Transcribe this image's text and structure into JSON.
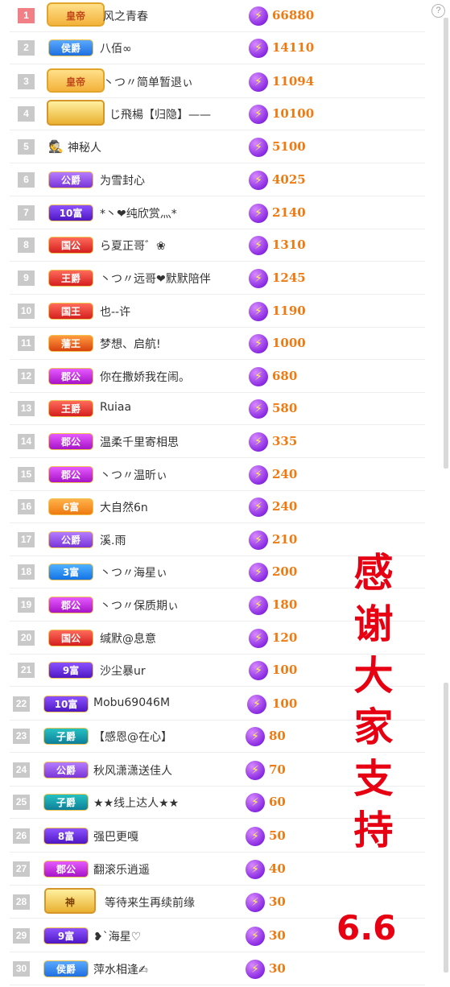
{
  "help_icon": "?",
  "coin_glyph": "⚡",
  "rows": [
    {
      "rank": "1",
      "badge": "皇帝",
      "badge_style": "crown",
      "name": "风之青春",
      "score": "66880"
    },
    {
      "rank": "2",
      "badge": "侯爵",
      "badge_style": "blue",
      "name": "八佰∞",
      "score": "14110"
    },
    {
      "rank": "3",
      "badge": "皇帝",
      "badge_style": "crown",
      "name": "丶つ〃简单暂退ぃ",
      "score": "11094"
    },
    {
      "rank": "4",
      "badge": "",
      "badge_style": "gold",
      "name": "じ飛楊【归隐】——",
      "score": "10100"
    },
    {
      "rank": "5",
      "badge": "",
      "badge_style": "mystery",
      "name": "神秘人",
      "score": "5100"
    },
    {
      "rank": "6",
      "badge": "公爵",
      "badge_style": "purple",
      "name": "为雪封心",
      "score": "4025"
    },
    {
      "rank": "7",
      "badge": "10富",
      "badge_style": "violet",
      "name": "*丶❤纯欣赏灬*",
      "score": "2140"
    },
    {
      "rank": "8",
      "badge": "国公",
      "badge_style": "red",
      "name": "ら夏正哥゛❀",
      "score": "1310"
    },
    {
      "rank": "9",
      "badge": "王爵",
      "badge_style": "red",
      "name": "丶つ〃远哥❤默默陪伴",
      "score": "1245"
    },
    {
      "rank": "10",
      "badge": "国王",
      "badge_style": "red",
      "name": "也--许",
      "score": "1190"
    },
    {
      "rank": "11",
      "badge": "藩王",
      "badge_style": "orange",
      "name": "梦想、启航!",
      "score": "1000"
    },
    {
      "rank": "12",
      "badge": "郡公",
      "badge_style": "magenta",
      "name": "你在撒娇我在闹。",
      "score": "680"
    },
    {
      "rank": "13",
      "badge": "王爵",
      "badge_style": "red",
      "name": "Ruiaa",
      "score": "580"
    },
    {
      "rank": "14",
      "badge": "郡公",
      "badge_style": "magenta",
      "name": "温柔千里寄相思",
      "score": "335"
    },
    {
      "rank": "15",
      "badge": "郡公",
      "badge_style": "magenta",
      "name": "丶つ〃温昕ぃ",
      "score": "240"
    },
    {
      "rank": "16",
      "badge": "6富",
      "badge_style": "orange2",
      "name": "大自然6n",
      "score": "240"
    },
    {
      "rank": "17",
      "badge": "公爵",
      "badge_style": "purple",
      "name": "溪.雨",
      "score": "210"
    },
    {
      "rank": "18",
      "badge": "3富",
      "badge_style": "blue2",
      "name": "丶つ〃海星ぃ",
      "score": "200"
    },
    {
      "rank": "19",
      "badge": "郡公",
      "badge_style": "magenta",
      "name": "丶つ〃保质期ぃ",
      "score": "180"
    },
    {
      "rank": "20",
      "badge": "国公",
      "badge_style": "red",
      "name": "缄默@息意",
      "score": "120"
    },
    {
      "rank": "21",
      "badge": "9富",
      "badge_style": "violet",
      "name": "沙尘暴ur",
      "score": "100"
    },
    {
      "rank": "22",
      "badge": "10富",
      "badge_style": "violet",
      "name": "Mobu69046M",
      "score": "100"
    },
    {
      "rank": "23",
      "badge": "子爵",
      "badge_style": "teal",
      "name": "【感恩@在心】",
      "score": "80"
    },
    {
      "rank": "24",
      "badge": "公爵",
      "badge_style": "purple",
      "name": "秋风潇潇送佳人",
      "score": "70"
    },
    {
      "rank": "25",
      "badge": "子爵",
      "badge_style": "teal",
      "name": "★★线上达人★★",
      "score": "60"
    },
    {
      "rank": "26",
      "badge": "8富",
      "badge_style": "violet",
      "name": "强巴更嘎",
      "score": "50"
    },
    {
      "rank": "27",
      "badge": "郡公",
      "badge_style": "magenta",
      "name": "翻滚乐逍遥",
      "score": "40"
    },
    {
      "rank": "28",
      "badge": "神",
      "badge_style": "gold2",
      "name": "等待来生再续前缘",
      "score": "30"
    },
    {
      "rank": "29",
      "badge": "9富",
      "badge_style": "violet",
      "name": "❥`海星♡",
      "score": "30"
    },
    {
      "rank": "30",
      "badge": "侯爵",
      "badge_style": "blue",
      "name": "萍水相逢✍",
      "score": "30"
    }
  ],
  "overlay": {
    "thanks_chars": [
      "感",
      "谢",
      "大",
      "家",
      "支",
      "持"
    ],
    "date": "6.6"
  },
  "colors": {
    "accent_red": "#e60012",
    "score_orange": "#f07a12",
    "rank_gray": "#c9c9c9",
    "rank_first": "#f07f86"
  }
}
